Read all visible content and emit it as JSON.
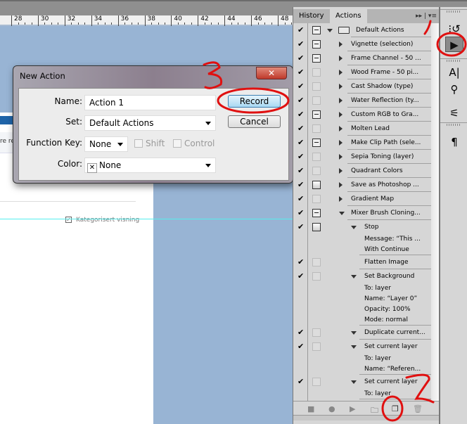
{
  "ruler": {
    "labels": [
      "28",
      "30",
      "32",
      "34",
      "36",
      "38",
      "40",
      "42",
      "44",
      "46",
      "48"
    ]
  },
  "document": {
    "partial_text": "re re",
    "checkbox_label": "Kategorisert visning"
  },
  "dialog": {
    "title": "New Action",
    "close_label": "✕",
    "name_label": "Name:",
    "name_value": "Action 1",
    "set_label": "Set:",
    "set_value": "Default Actions",
    "function_key_label": "Function Key:",
    "function_key_value": "None",
    "shift_label": "Shift",
    "control_label": "Control",
    "color_label": "Color:",
    "color_value": "None",
    "record_label": "Record",
    "cancel_label": "Cancel"
  },
  "panel": {
    "tabs": [
      {
        "label": "History"
      },
      {
        "label": "Actions",
        "active": true
      }
    ],
    "menu_glyph": "▸▸ | ▾≡",
    "items": [
      {
        "kind": "row",
        "level": 0,
        "check": true,
        "box": "dialog",
        "tri": "down",
        "label": "Default Actions"
      },
      {
        "kind": "row",
        "level": 1,
        "check": true,
        "box": "dialog",
        "tri": "right",
        "label": "Vignette (selection)"
      },
      {
        "kind": "row",
        "level": 1,
        "check": true,
        "box": "dialog",
        "tri": "right",
        "label": "Frame Channel - 50 ..."
      },
      {
        "kind": "row",
        "level": 1,
        "check": true,
        "box": "empty",
        "tri": "right",
        "label": "Wood Frame - 50 pi..."
      },
      {
        "kind": "row",
        "level": 1,
        "check": true,
        "box": "empty",
        "tri": "right",
        "label": "Cast Shadow (type)"
      },
      {
        "kind": "row",
        "level": 1,
        "check": true,
        "box": "empty",
        "tri": "right",
        "label": "Water Reflection (ty..."
      },
      {
        "kind": "row",
        "level": 1,
        "check": true,
        "box": "dialog",
        "tri": "right",
        "label": "Custom RGB to Gra..."
      },
      {
        "kind": "row",
        "level": 1,
        "check": true,
        "box": "empty",
        "tri": "right",
        "label": "Molten Lead"
      },
      {
        "kind": "row",
        "level": 1,
        "check": true,
        "box": "dialog",
        "tri": "right",
        "label": "Make Clip Path (sele..."
      },
      {
        "kind": "row",
        "level": 1,
        "check": true,
        "box": "empty",
        "tri": "right",
        "label": "Sepia Toning (layer)"
      },
      {
        "kind": "row",
        "level": 1,
        "check": true,
        "box": "empty",
        "tri": "right",
        "label": "Quadrant Colors"
      },
      {
        "kind": "row",
        "level": 1,
        "check": true,
        "box": "dialog2",
        "tri": "right",
        "label": "Save as Photoshop ..."
      },
      {
        "kind": "row",
        "level": 1,
        "check": true,
        "box": "empty",
        "tri": "right",
        "label": "Gradient Map"
      },
      {
        "kind": "row",
        "level": 1,
        "check": true,
        "box": "dialog",
        "tri": "down",
        "label": "Mixer Brush Cloning..."
      },
      {
        "kind": "row",
        "level": 2,
        "check": true,
        "box": "dialog2",
        "tri": "down",
        "label": "Stop"
      },
      {
        "kind": "detail",
        "label": "Message:  “This ..."
      },
      {
        "kind": "detail",
        "label": "With Continue"
      },
      {
        "kind": "row",
        "level": 2,
        "check": true,
        "box": "empty",
        "tri": "none",
        "label": "Flatten Image"
      },
      {
        "kind": "row",
        "level": 2,
        "check": true,
        "box": "empty",
        "tri": "down",
        "label": "Set Background"
      },
      {
        "kind": "detail",
        "label": "To: layer"
      },
      {
        "kind": "detail",
        "label": "Name:  “Layer 0”"
      },
      {
        "kind": "detail",
        "label": "Opacity: 100%"
      },
      {
        "kind": "detail",
        "label": "Mode: normal"
      },
      {
        "kind": "row",
        "level": 2,
        "check": true,
        "box": "empty",
        "tri": "down",
        "label": "Duplicate current..."
      },
      {
        "kind": "row",
        "level": 2,
        "check": true,
        "box": "empty",
        "tri": "down",
        "label": "Set current layer"
      },
      {
        "kind": "detail",
        "label": "To: layer"
      },
      {
        "kind": "detail",
        "label": "Name:  “Referen..."
      },
      {
        "kind": "row",
        "level": 2,
        "check": true,
        "box": "empty",
        "tri": "down",
        "label": "Set current layer"
      },
      {
        "kind": "detail",
        "label": "To: layer"
      }
    ],
    "bottom_buttons": [
      {
        "name": "stop-icon",
        "glyph": "■"
      },
      {
        "name": "record-icon",
        "glyph": "●"
      },
      {
        "name": "play-icon",
        "glyph": "▶"
      },
      {
        "name": "new-set-folder-icon",
        "glyph": "🗀"
      },
      {
        "name": "new-action-icon",
        "glyph": "❐"
      },
      {
        "name": "delete-trash-icon",
        "glyph": "🗑"
      }
    ]
  },
  "toolbar": {
    "tools": [
      {
        "name": "history-icon",
        "glyph": "⁝↺"
      },
      {
        "name": "actions-play-icon",
        "glyph": "▶"
      },
      {
        "name": "character-icon",
        "glyph": "A|"
      },
      {
        "name": "brush-presets-icon",
        "glyph": "⚲"
      },
      {
        "name": "brush-icon",
        "glyph": "⚟"
      },
      {
        "name": "paragraph-icon",
        "glyph": "¶"
      }
    ]
  },
  "annotations": {
    "color": "#e01010",
    "labels": [
      "1",
      "2",
      "3"
    ]
  },
  "colors": {
    "canvas": "#98b4d4",
    "panel": "#d6d6d6",
    "annotation": "#e01010"
  }
}
